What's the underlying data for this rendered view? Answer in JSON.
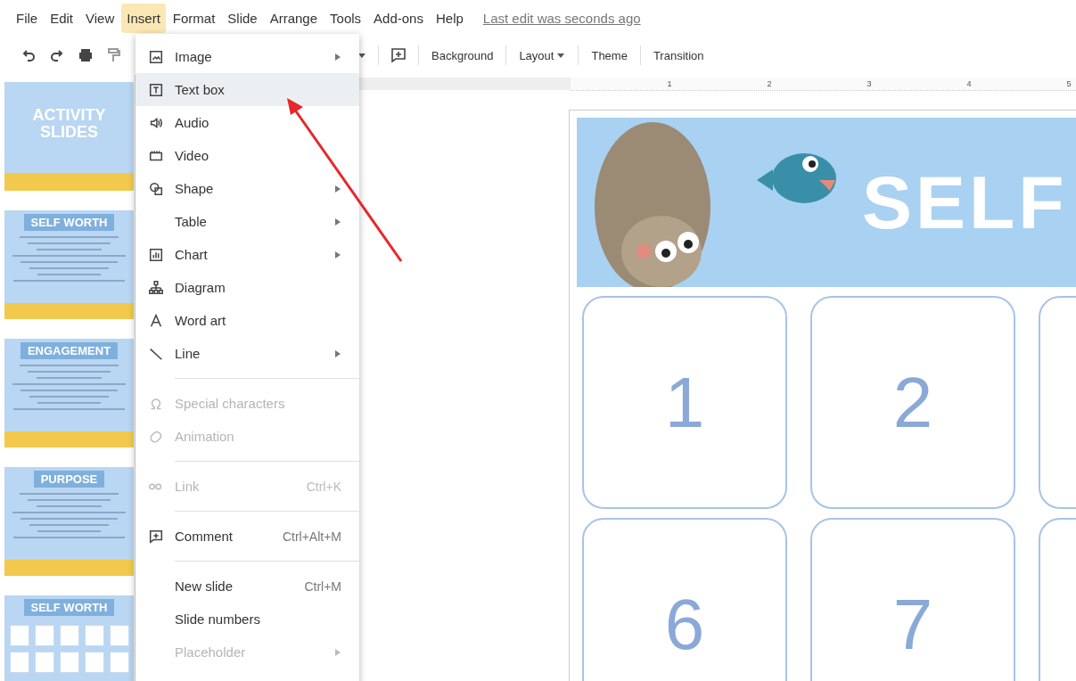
{
  "menubar": {
    "items": [
      {
        "label": "File",
        "selected": false
      },
      {
        "label": "Edit",
        "selected": false
      },
      {
        "label": "View",
        "selected": false
      },
      {
        "label": "Insert",
        "selected": true
      },
      {
        "label": "Format",
        "selected": false
      },
      {
        "label": "Slide",
        "selected": false
      },
      {
        "label": "Arrange",
        "selected": false
      },
      {
        "label": "Tools",
        "selected": false
      },
      {
        "label": "Add-ons",
        "selected": false
      },
      {
        "label": "Help",
        "selected": false
      }
    ],
    "last_edit": "Last edit was seconds ago"
  },
  "toolbar": {
    "buttons": [
      "Background",
      "Layout",
      "Theme",
      "Transition"
    ]
  },
  "ruler": {
    "marks": [
      "1",
      "2",
      "3",
      "4",
      "5"
    ]
  },
  "filmstrip": {
    "slides": [
      {
        "kind": "cover",
        "title": "ACTIVITY SLIDES"
      },
      {
        "kind": "list",
        "title": "SELF WORTH"
      },
      {
        "kind": "list",
        "title": "ENGAGEMENT"
      },
      {
        "kind": "list",
        "title": "PURPOSE"
      },
      {
        "kind": "grid",
        "title": "SELF WORTH"
      }
    ]
  },
  "insert_menu": {
    "groups": [
      [
        {
          "label": "Image",
          "submenu": true,
          "disabled": false,
          "highlighted": false
        },
        {
          "label": "Text box",
          "submenu": false,
          "disabled": false,
          "highlighted": true
        },
        {
          "label": "Audio",
          "submenu": false,
          "disabled": false,
          "highlighted": false
        },
        {
          "label": "Video",
          "submenu": false,
          "disabled": false,
          "highlighted": false
        },
        {
          "label": "Shape",
          "submenu": true,
          "disabled": false,
          "highlighted": false
        },
        {
          "label": "Table",
          "submenu": true,
          "disabled": false,
          "highlighted": false
        },
        {
          "label": "Chart",
          "submenu": true,
          "disabled": false,
          "highlighted": false
        },
        {
          "label": "Diagram",
          "submenu": false,
          "disabled": false,
          "highlighted": false
        },
        {
          "label": "Word art",
          "submenu": false,
          "disabled": false,
          "highlighted": false
        },
        {
          "label": "Line",
          "submenu": true,
          "disabled": false,
          "highlighted": false
        }
      ],
      [
        {
          "label": "Special characters",
          "submenu": false,
          "disabled": true,
          "highlighted": false
        },
        {
          "label": "Animation",
          "submenu": false,
          "disabled": true,
          "highlighted": false
        }
      ],
      [
        {
          "label": "Link",
          "shortcut": "Ctrl+K",
          "submenu": false,
          "disabled": true,
          "highlighted": false
        }
      ],
      [
        {
          "label": "Comment",
          "shortcut": "Ctrl+Alt+M",
          "submenu": false,
          "disabled": false,
          "highlighted": false
        }
      ],
      [
        {
          "label": "New slide",
          "shortcut": "Ctrl+M",
          "submenu": false,
          "disabled": false,
          "highlighted": false
        },
        {
          "label": "Slide numbers",
          "submenu": false,
          "disabled": false,
          "highlighted": false
        },
        {
          "label": "Placeholder",
          "submenu": true,
          "disabled": true,
          "highlighted": false
        }
      ]
    ]
  },
  "slide": {
    "title": "SELF",
    "cards": [
      [
        "1",
        "2"
      ],
      [
        "6",
        "7"
      ]
    ]
  }
}
